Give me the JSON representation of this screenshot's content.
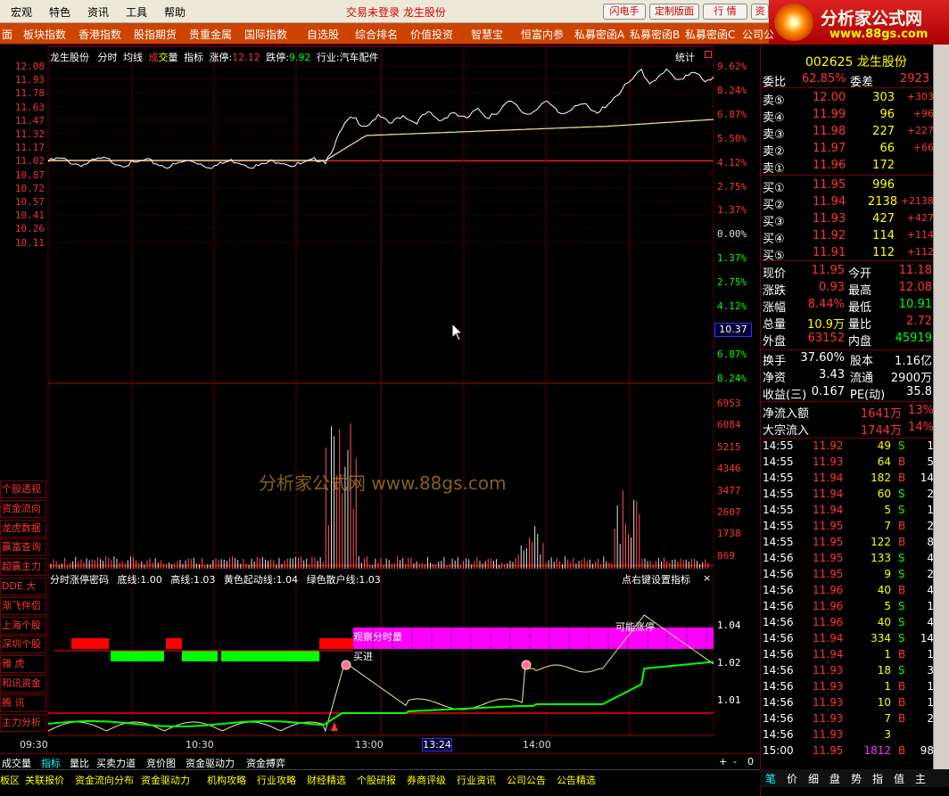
{
  "menubar": {
    "items": [
      "宏观",
      "特色",
      "资讯",
      "工具",
      "帮助"
    ],
    "center": "交易未登录  龙生股份",
    "buttons": [
      "闪电手",
      "定制版面",
      "行  情",
      "资"
    ]
  },
  "logo": {
    "title": "分析家公式网",
    "url": "www.88gs.com"
  },
  "tabs": [
    "面",
    "板块指数",
    "香港指数",
    "股指期货",
    "贵重金属",
    "国际指数",
    "自选股",
    "综合排名",
    "价值投资",
    "智慧宝",
    "恒富内参",
    "私募密函A",
    "私募密函B",
    "私募密函C",
    "公司公"
  ],
  "chart": {
    "header": {
      "name": "龙生股份",
      "items": [
        "分时",
        "均线",
        "成",
        "交",
        "量",
        "指标"
      ],
      "limit_up_label": "涨停:",
      "limit_up": "12.12",
      "limit_down_label": "跌停:",
      "limit_down": "9.92",
      "industry": "行业:汽车配件",
      "stats": "统计"
    },
    "price_left": [
      "12.08",
      "11.93",
      "11.78",
      "11.63",
      "11.47",
      "11.32",
      "11.17",
      "11.02",
      "10.87",
      "10.72",
      "10.57",
      "10.41",
      "10.26",
      "10.11"
    ],
    "pct_right": [
      "9.62%",
      "8.24%",
      "6.87%",
      "5.50%",
      "4.12%",
      "2.75%",
      "1.37%",
      "0.00%",
      "1.37%",
      "2.75%",
      "4.12%",
      "5.50%",
      "6.87%",
      "8.24%"
    ],
    "cursor_value": "10.37",
    "volume_right": [
      "6953",
      "6084",
      "5215",
      "4346",
      "3477",
      "2607",
      "1738",
      "869"
    ],
    "watermark": "分析家公式网  www.88gs.com",
    "indicator_header": {
      "name": "分时涨停密码",
      "items": [
        "底线:1.00",
        "高线:1.03",
        "黄色起动线:1.04",
        "绿色散户线:1.03"
      ],
      "setting": "点右键设置指标",
      "close": "×"
    },
    "indicator_right": [
      "1.04",
      "1.02",
      "1.01"
    ],
    "ind_labels": {
      "buy": "买进",
      "watch": "观察分时量",
      "may_limit": "可能涨停"
    },
    "time_labels": [
      "09:30",
      "10:30",
      "13:00",
      "14:00"
    ],
    "cursor_time": "13:24",
    "side_buttons": [
      "个股透视",
      "资金流向",
      "龙虎数据",
      "赢富查询",
      "超赢主力",
      "DDE 大单",
      "渐飞伴侣",
      "上海个股",
      "深圳个股",
      "雅    虎",
      "和讯资金",
      "腾    讯",
      "主力分析"
    ]
  },
  "quote": {
    "code": "002625",
    "name": "龙生股份",
    "weibi_label": "委比",
    "weibi": "62.85%",
    "weicha_label": "委差",
    "weicha": "2923",
    "sell": [
      {
        "l": "卖⑤",
        "p": "12.00",
        "v": "303",
        "d": "+303"
      },
      {
        "l": "卖④",
        "p": "11.99",
        "v": "96",
        "d": "+96"
      },
      {
        "l": "卖③",
        "p": "11.98",
        "v": "227",
        "d": "+227"
      },
      {
        "l": "卖②",
        "p": "11.97",
        "v": "66",
        "d": "+66"
      },
      {
        "l": "卖①",
        "p": "11.96",
        "v": "172",
        "d": ""
      }
    ],
    "buy": [
      {
        "l": "买①",
        "p": "11.95",
        "v": "996",
        "d": ""
      },
      {
        "l": "买②",
        "p": "11.94",
        "v": "2138",
        "d": "+2138"
      },
      {
        "l": "买③",
        "p": "11.93",
        "v": "427",
        "d": "+427"
      },
      {
        "l": "买④",
        "p": "11.92",
        "v": "114",
        "d": "+114"
      },
      {
        "l": "买⑤",
        "p": "11.91",
        "v": "112",
        "d": "+112"
      }
    ],
    "stats": [
      {
        "l1": "现价",
        "v1": "11.95",
        "l2": "今开",
        "v2": "11.18",
        "c1": "red",
        "c2": "red"
      },
      {
        "l1": "涨跌",
        "v1": "0.93",
        "l2": "最高",
        "v2": "12.08",
        "c1": "red",
        "c2": "red"
      },
      {
        "l1": "涨幅",
        "v1": "8.44%",
        "l2": "最低",
        "v2": "10.91",
        "c1": "red",
        "c2": "grn"
      },
      {
        "l1": "总量",
        "v1": "10.9万",
        "l2": "量比",
        "v2": "2.72",
        "c1": "yel",
        "c2": "red"
      },
      {
        "l1": "外盘",
        "v1": "63152",
        "l2": "内盘",
        "v2": "45919",
        "c1": "red",
        "c2": "grn"
      }
    ],
    "stats2": [
      {
        "l1": "换手",
        "v1": "37.60%",
        "l2": "股本",
        "v2": "1.16亿"
      },
      {
        "l1": "净资",
        "v1": "3.43",
        "l2": "流通",
        "v2": "2900万"
      },
      {
        "l1": "收益(三)",
        "v1": "0.167",
        "l2": "PE(动)",
        "v2": "35.8"
      }
    ],
    "flow": [
      {
        "l": "净流入额",
        "v": "1641万",
        "p": "13%"
      },
      {
        "l": "大宗流入",
        "v": "1744万",
        "p": "14%"
      }
    ],
    "ticks": [
      [
        "14:55",
        "11.92",
        "49",
        "S",
        "1"
      ],
      [
        "14:55",
        "11.93",
        "64",
        "B",
        "5"
      ],
      [
        "14:55",
        "11.94",
        "182",
        "B",
        "14"
      ],
      [
        "14:55",
        "11.94",
        "60",
        "S",
        "2"
      ],
      [
        "14:55",
        "11.94",
        "5",
        "S",
        "1"
      ],
      [
        "14:55",
        "11.95",
        "7",
        "B",
        "2"
      ],
      [
        "14:55",
        "11.95",
        "122",
        "B",
        "8"
      ],
      [
        "14:56",
        "11.95",
        "133",
        "S",
        "4"
      ],
      [
        "14:56",
        "11.95",
        "9",
        "S",
        "2"
      ],
      [
        "14:56",
        "11.96",
        "40",
        "B",
        "4"
      ],
      [
        "14:56",
        "11.96",
        "5",
        "S",
        "1"
      ],
      [
        "14:56",
        "11.96",
        "40",
        "S",
        "4"
      ],
      [
        "14:56",
        "11.94",
        "334",
        "S",
        "14"
      ],
      [
        "14:56",
        "11.94",
        "1",
        "B",
        "1"
      ],
      [
        "14:56",
        "11.93",
        "18",
        "S",
        "3"
      ],
      [
        "14:56",
        "11.93",
        "1",
        "B",
        "1"
      ],
      [
        "14:56",
        "11.93",
        "10",
        "B",
        "1"
      ],
      [
        "14:56",
        "11.93",
        "7",
        "B",
        "2"
      ],
      [
        "14:56",
        "11.93",
        "3",
        "",
        ""
      ],
      [
        "15:00",
        "11.95",
        "1812",
        "B",
        "98"
      ]
    ]
  },
  "bottom_tabs": [
    "成交量",
    "指标",
    "量比",
    "买卖力道",
    "竞价图",
    "资金驱动力",
    "资金搏弈"
  ],
  "bottom_ctrl": [
    "+",
    "-",
    "0"
  ],
  "status_items": [
    "板区",
    "关联报价",
    "资金流向分布",
    "资金驱动力",
    "机构攻略",
    "行业攻略",
    "财经精选",
    "个股研报",
    "券商评级",
    "行业资讯",
    "公司公告",
    "公告精选"
  ],
  "right_tabs": [
    "笔",
    "价",
    "细",
    "盘",
    "势",
    "指",
    "值",
    "主"
  ],
  "chart_data": {
    "type": "line",
    "x": [
      "09:30",
      "10:30",
      "13:00",
      "14:00"
    ],
    "ylim": [
      10.11,
      12.08
    ]
  }
}
